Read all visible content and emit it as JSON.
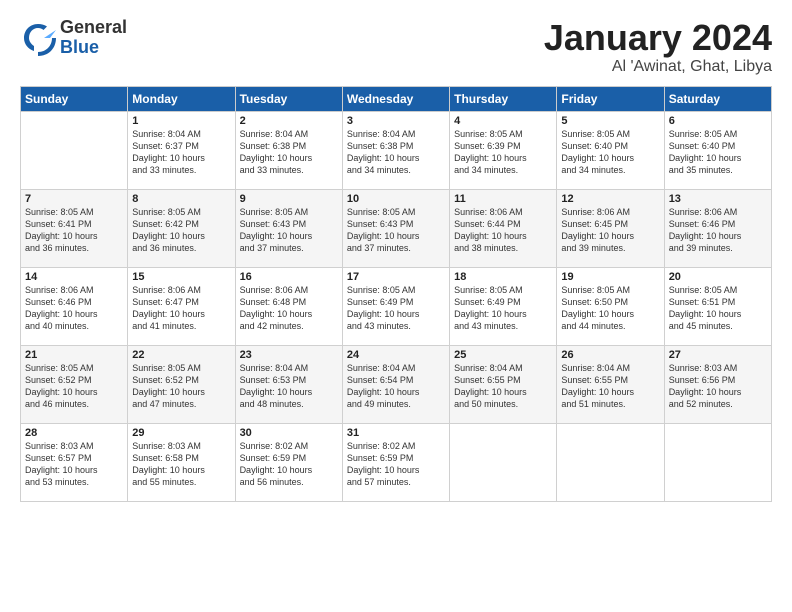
{
  "header": {
    "logo_general": "General",
    "logo_blue": "Blue",
    "calendar_title": "January 2024",
    "calendar_subtitle": "Al 'Awinat, Ghat, Libya"
  },
  "weekdays": [
    "Sunday",
    "Monday",
    "Tuesday",
    "Wednesday",
    "Thursday",
    "Friday",
    "Saturday"
  ],
  "weeks": [
    [
      {
        "day": "",
        "info": ""
      },
      {
        "day": "1",
        "info": "Sunrise: 8:04 AM\nSunset: 6:37 PM\nDaylight: 10 hours\nand 33 minutes."
      },
      {
        "day": "2",
        "info": "Sunrise: 8:04 AM\nSunset: 6:38 PM\nDaylight: 10 hours\nand 33 minutes."
      },
      {
        "day": "3",
        "info": "Sunrise: 8:04 AM\nSunset: 6:38 PM\nDaylight: 10 hours\nand 34 minutes."
      },
      {
        "day": "4",
        "info": "Sunrise: 8:05 AM\nSunset: 6:39 PM\nDaylight: 10 hours\nand 34 minutes."
      },
      {
        "day": "5",
        "info": "Sunrise: 8:05 AM\nSunset: 6:40 PM\nDaylight: 10 hours\nand 34 minutes."
      },
      {
        "day": "6",
        "info": "Sunrise: 8:05 AM\nSunset: 6:40 PM\nDaylight: 10 hours\nand 35 minutes."
      }
    ],
    [
      {
        "day": "7",
        "info": "Sunrise: 8:05 AM\nSunset: 6:41 PM\nDaylight: 10 hours\nand 36 minutes."
      },
      {
        "day": "8",
        "info": "Sunrise: 8:05 AM\nSunset: 6:42 PM\nDaylight: 10 hours\nand 36 minutes."
      },
      {
        "day": "9",
        "info": "Sunrise: 8:05 AM\nSunset: 6:43 PM\nDaylight: 10 hours\nand 37 minutes."
      },
      {
        "day": "10",
        "info": "Sunrise: 8:05 AM\nSunset: 6:43 PM\nDaylight: 10 hours\nand 37 minutes."
      },
      {
        "day": "11",
        "info": "Sunrise: 8:06 AM\nSunset: 6:44 PM\nDaylight: 10 hours\nand 38 minutes."
      },
      {
        "day": "12",
        "info": "Sunrise: 8:06 AM\nSunset: 6:45 PM\nDaylight: 10 hours\nand 39 minutes."
      },
      {
        "day": "13",
        "info": "Sunrise: 8:06 AM\nSunset: 6:46 PM\nDaylight: 10 hours\nand 39 minutes."
      }
    ],
    [
      {
        "day": "14",
        "info": "Sunrise: 8:06 AM\nSunset: 6:46 PM\nDaylight: 10 hours\nand 40 minutes."
      },
      {
        "day": "15",
        "info": "Sunrise: 8:06 AM\nSunset: 6:47 PM\nDaylight: 10 hours\nand 41 minutes."
      },
      {
        "day": "16",
        "info": "Sunrise: 8:06 AM\nSunset: 6:48 PM\nDaylight: 10 hours\nand 42 minutes."
      },
      {
        "day": "17",
        "info": "Sunrise: 8:05 AM\nSunset: 6:49 PM\nDaylight: 10 hours\nand 43 minutes."
      },
      {
        "day": "18",
        "info": "Sunrise: 8:05 AM\nSunset: 6:49 PM\nDaylight: 10 hours\nand 43 minutes."
      },
      {
        "day": "19",
        "info": "Sunrise: 8:05 AM\nSunset: 6:50 PM\nDaylight: 10 hours\nand 44 minutes."
      },
      {
        "day": "20",
        "info": "Sunrise: 8:05 AM\nSunset: 6:51 PM\nDaylight: 10 hours\nand 45 minutes."
      }
    ],
    [
      {
        "day": "21",
        "info": "Sunrise: 8:05 AM\nSunset: 6:52 PM\nDaylight: 10 hours\nand 46 minutes."
      },
      {
        "day": "22",
        "info": "Sunrise: 8:05 AM\nSunset: 6:52 PM\nDaylight: 10 hours\nand 47 minutes."
      },
      {
        "day": "23",
        "info": "Sunrise: 8:04 AM\nSunset: 6:53 PM\nDaylight: 10 hours\nand 48 minutes."
      },
      {
        "day": "24",
        "info": "Sunrise: 8:04 AM\nSunset: 6:54 PM\nDaylight: 10 hours\nand 49 minutes."
      },
      {
        "day": "25",
        "info": "Sunrise: 8:04 AM\nSunset: 6:55 PM\nDaylight: 10 hours\nand 50 minutes."
      },
      {
        "day": "26",
        "info": "Sunrise: 8:04 AM\nSunset: 6:55 PM\nDaylight: 10 hours\nand 51 minutes."
      },
      {
        "day": "27",
        "info": "Sunrise: 8:03 AM\nSunset: 6:56 PM\nDaylight: 10 hours\nand 52 minutes."
      }
    ],
    [
      {
        "day": "28",
        "info": "Sunrise: 8:03 AM\nSunset: 6:57 PM\nDaylight: 10 hours\nand 53 minutes."
      },
      {
        "day": "29",
        "info": "Sunrise: 8:03 AM\nSunset: 6:58 PM\nDaylight: 10 hours\nand 55 minutes."
      },
      {
        "day": "30",
        "info": "Sunrise: 8:02 AM\nSunset: 6:59 PM\nDaylight: 10 hours\nand 56 minutes."
      },
      {
        "day": "31",
        "info": "Sunrise: 8:02 AM\nSunset: 6:59 PM\nDaylight: 10 hours\nand 57 minutes."
      },
      {
        "day": "",
        "info": ""
      },
      {
        "day": "",
        "info": ""
      },
      {
        "day": "",
        "info": ""
      }
    ]
  ]
}
